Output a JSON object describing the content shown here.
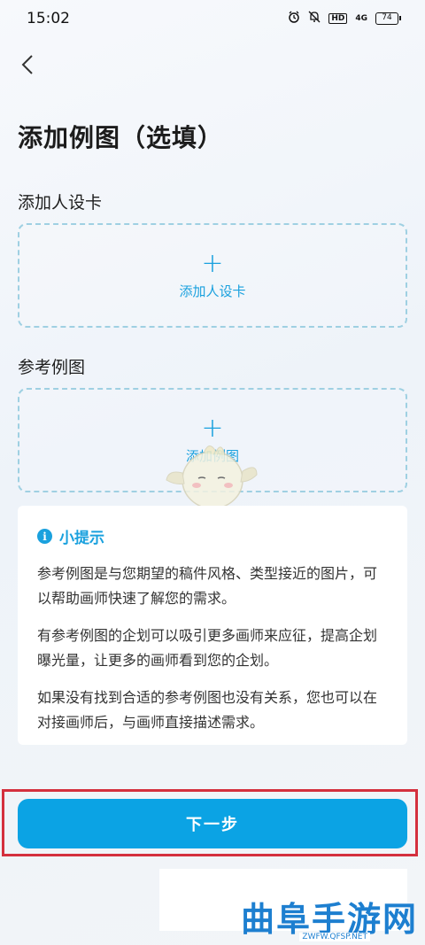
{
  "status_bar": {
    "time": "15:02",
    "hd": "HD",
    "network": "4G",
    "battery": "74"
  },
  "header": {
    "title": "添加例图（选填）"
  },
  "sections": [
    {
      "label": "添加人设卡",
      "plus": "+",
      "button_text": "添加人设卡"
    },
    {
      "label": "参考例图",
      "plus": "+",
      "button_text": "添加例图"
    }
  ],
  "tips": {
    "icon": "i",
    "title": "小提示",
    "paragraphs": [
      "参考例图是与您期望的稿件风格、类型接近的图片，可以帮助画师快速了解您的需求。",
      "有参考例图的企划可以吸引更多画师来应征，提高企划曝光量，让更多的画师看到您的企划。",
      "如果没有找到合适的参考例图也没有关系，您也可以在对接画师后，与画师直接描述需求。"
    ]
  },
  "footer": {
    "next_button": "下一步"
  },
  "watermark": {
    "text": "曲阜手游网",
    "url": "ZWFW.QFSP.NET"
  },
  "colors": {
    "accent": "#1aa1de",
    "button": "#0ba3e4",
    "highlight": "#d4303e"
  }
}
